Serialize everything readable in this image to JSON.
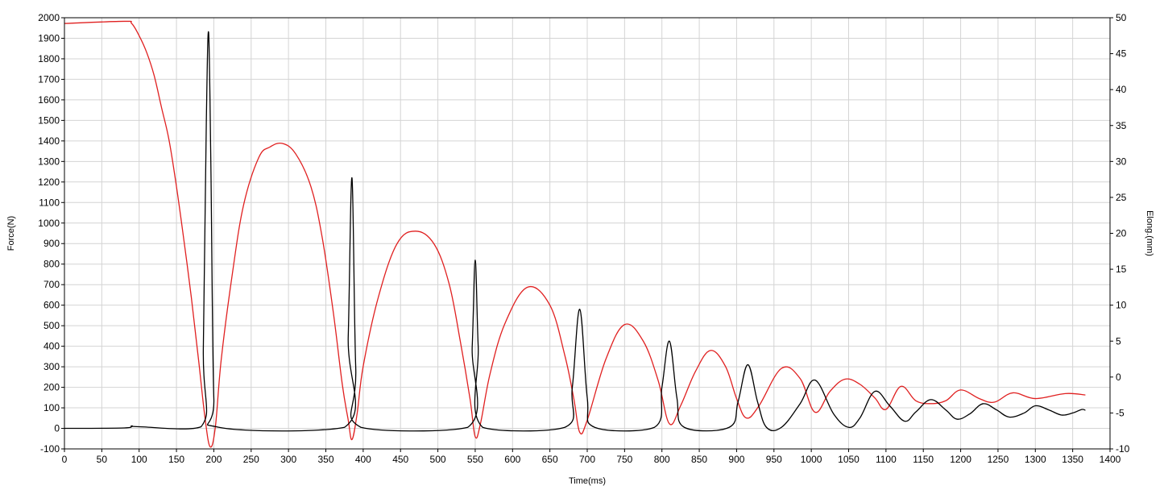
{
  "chart_data": {
    "type": "line",
    "xlabel": "Time(ms)",
    "ylabel_left": "Force(N)",
    "ylabel_right": "Elong.(mm)",
    "xlim": [
      0,
      1400
    ],
    "ylim_left": [
      -100,
      2000
    ],
    "ylim_right": [
      -10,
      50
    ],
    "x_ticks": [
      "0",
      "50",
      "100",
      "150",
      "200",
      "250",
      "300",
      "350",
      "400",
      "450",
      "500",
      "550",
      "600",
      "650",
      "700",
      "750",
      "800",
      "850",
      "900",
      "950",
      "1000",
      "1050",
      "1100",
      "1150",
      "1200",
      "1250",
      "1300",
      "1350",
      "1400"
    ],
    "y_left_ticks": [
      "-100",
      "0",
      "100",
      "200",
      "300",
      "400",
      "500",
      "600",
      "700",
      "800",
      "900",
      "1000",
      "1100",
      "1200",
      "1300",
      "1400",
      "1500",
      "1600",
      "1700",
      "1800",
      "1900",
      "2000"
    ],
    "y_right_ticks": [
      "-10",
      "-5",
      "0",
      "5",
      "10",
      "15",
      "20",
      "25",
      "30",
      "35",
      "40",
      "45",
      "50"
    ],
    "grid": true,
    "series": [
      {
        "axis": "left",
        "color": "#000000",
        "x": [
          0,
          80,
          90,
          100,
          183,
          186,
          190,
          193,
          196,
          200,
          207,
          375,
          380,
          385,
          390,
          397,
          540,
          546,
          550,
          554,
          560,
          670,
          680,
          690,
          700,
          710,
          790,
          800,
          810,
          820,
          830,
          890,
          902,
          915,
          928,
          940,
          960,
          985,
          1005,
          1030,
          1050,
          1065,
          1085,
          1105,
          1125,
          1140,
          1160,
          1180,
          1195,
          1212,
          1230,
          1248,
          1265,
          1285,
          1300,
          1318,
          1335,
          1350,
          1362,
          1367
        ],
        "y": [
          0,
          2,
          12,
          8,
          8,
          400,
          1500,
          1930,
          1300,
          150,
          5,
          5,
          450,
          1220,
          300,
          5,
          5,
          400,
          820,
          400,
          5,
          5,
          200,
          580,
          150,
          5,
          5,
          200,
          425,
          150,
          5,
          5,
          130,
          310,
          130,
          5,
          5,
          120,
          235,
          70,
          5,
          50,
          180,
          110,
          35,
          80,
          140,
          90,
          45,
          70,
          120,
          90,
          55,
          75,
          110,
          90,
          65,
          75,
          92,
          88
        ]
      },
      {
        "axis": "right",
        "color": "#e02020",
        "x": [
          0,
          80,
          90,
          100,
          110,
          120,
          130,
          140,
          150,
          160,
          170,
          180,
          188,
          195,
          202,
          210,
          225,
          240,
          260,
          275,
          292,
          310,
          330,
          345,
          360,
          372,
          380,
          385,
          392,
          400,
          420,
          445,
          470,
          495,
          515,
          530,
          543,
          550,
          557,
          570,
          590,
          620,
          650,
          670,
          682,
          690,
          700,
          725,
          750,
          775,
          795,
          810,
          825,
          845,
          865,
          885,
          900,
          913,
          930,
          960,
          985,
          1005,
          1025,
          1045,
          1065,
          1085,
          1100,
          1120,
          1140,
          1160,
          1180,
          1200,
          1225,
          1245,
          1270,
          1300,
          1340,
          1367
        ],
        "y": [
          49.2,
          49.5,
          49.2,
          47.5,
          45.2,
          42.0,
          37.5,
          33.0,
          26.5,
          19.0,
          11.0,
          2.0,
          -5.5,
          -9.7,
          -7.0,
          2.5,
          14.5,
          24.0,
          30.5,
          32.0,
          32.5,
          31.0,
          26.5,
          19.5,
          9.0,
          -1.0,
          -6.0,
          -8.7,
          -5.0,
          1.5,
          11.0,
          18.5,
          20.3,
          18.5,
          13.0,
          5.0,
          -3.0,
          -8.3,
          -6.5,
          0.5,
          7.5,
          12.5,
          10.0,
          3.0,
          -3.0,
          -7.7,
          -6.0,
          2.5,
          7.3,
          5.0,
          -0.5,
          -6.5,
          -4.0,
          0.8,
          3.7,
          1.5,
          -3.0,
          -5.7,
          -4.0,
          1.2,
          -0.2,
          -4.9,
          -2.0,
          -0.3,
          -1.0,
          -2.9,
          -4.5,
          -1.3,
          -3.3,
          -3.7,
          -3.3,
          -1.8,
          -3.0,
          -3.5,
          -2.2,
          -3.0,
          -2.3,
          -2.5
        ]
      }
    ]
  }
}
